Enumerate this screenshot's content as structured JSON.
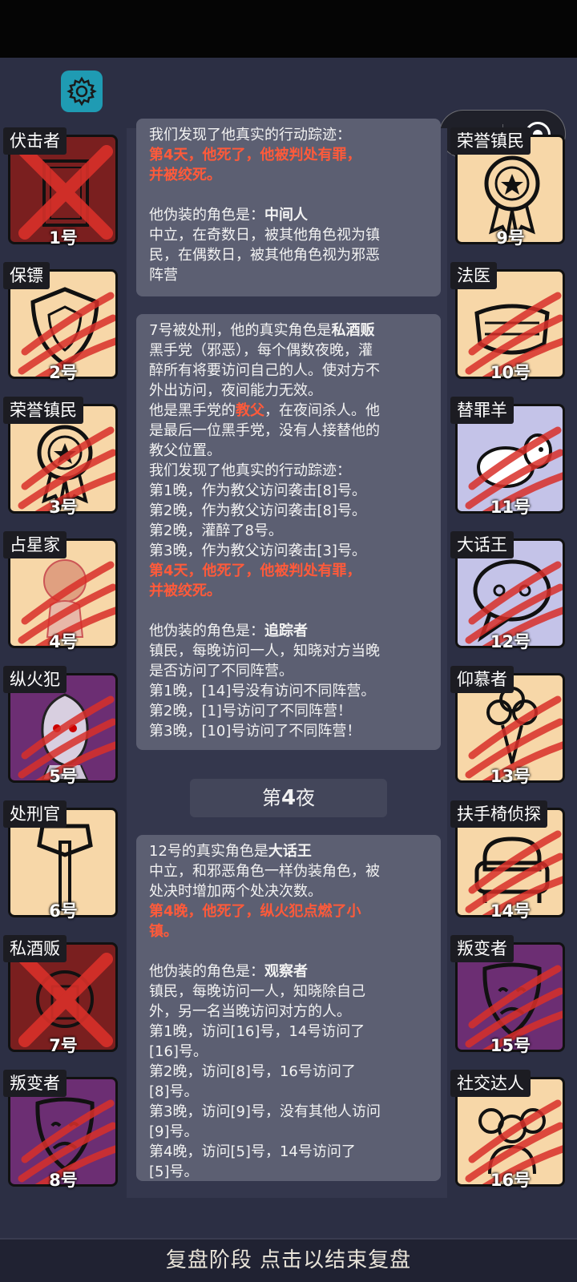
{
  "icons": {
    "settings": "gear-icon",
    "menu": "more-dots-icon",
    "close": "target-close-icon"
  },
  "colors": {
    "background": "#2c2f44",
    "card": "#5c5f72",
    "highlight": "#ff5a3a",
    "settings_button": "#1f9bb3",
    "tile_town": "#f7d7a8",
    "tile_evil": "#6c2e73",
    "tile_neutral": "#c4c3e8"
  },
  "players": [
    {
      "role": "伏击者",
      "number": "1号",
      "icon": "door-icon",
      "tile": "dark",
      "status": "executed"
    },
    {
      "role": "保镖",
      "number": "2号",
      "icon": "shield-icon",
      "tile": "town",
      "status": "clawed"
    },
    {
      "role": "荣誉镇民",
      "number": "3号",
      "icon": "medal-icon",
      "tile": "town",
      "status": "clawed"
    },
    {
      "role": "占星家",
      "number": "4号",
      "icon": "astrologer-icon",
      "tile": "town",
      "status": "clawed"
    },
    {
      "role": "纵火犯",
      "number": "5号",
      "icon": "arsonist-icon",
      "tile": "purple",
      "status": "clawed"
    },
    {
      "role": "处刑官",
      "number": "6号",
      "icon": "axe-icon",
      "tile": "town",
      "status": "alive"
    },
    {
      "role": "私酒贩",
      "number": "7号",
      "icon": "bootlegger-icon",
      "tile": "dark",
      "status": "executed"
    },
    {
      "role": "叛变者",
      "number": "8号",
      "icon": "theater-mask-icon",
      "tile": "purple",
      "status": "clawed"
    },
    {
      "role": "荣誉镇民",
      "number": "9号",
      "icon": "medal-icon",
      "tile": "town",
      "status": "alive"
    },
    {
      "role": "法医",
      "number": "10号",
      "icon": "mask-icon",
      "tile": "town",
      "status": "clawed"
    },
    {
      "role": "替罪羊",
      "number": "11号",
      "icon": "sheep-icon",
      "tile": "lavender",
      "status": "clawed"
    },
    {
      "role": "大话王",
      "number": "12号",
      "icon": "speech-bubble-icon",
      "tile": "lavender",
      "status": "clawed"
    },
    {
      "role": "仰慕者",
      "number": "13号",
      "icon": "bouquet-icon",
      "tile": "town",
      "status": "clawed"
    },
    {
      "role": "扶手椅侦探",
      "number": "14号",
      "icon": "armchair-icon",
      "tile": "town",
      "status": "clawed"
    },
    {
      "role": "叛变者",
      "number": "15号",
      "icon": "theater-mask-icon",
      "tile": "purple",
      "status": "clawed"
    },
    {
      "role": "社交达人",
      "number": "16号",
      "icon": "people-icon",
      "tile": "town",
      "status": "clawed"
    }
  ],
  "log": {
    "card1": {
      "lines": [
        "我们发现了他真实的行动踪迹：",
        "第4天，他死了，他被判处有罪，",
        "并被绞死。",
        "他伪装的角色是：",
        "中间人",
        "中立，在奇数日，被其他角色视为镇",
        "民，在偶数日，被其他角色视为邪恶",
        "阵营"
      ]
    },
    "card2": {
      "lines": [
        "7号被处刑，他的真实角色是",
        "私酒贩",
        "黑手党（邪恶），每个偶数夜晚，灌",
        "醉所有将要访问自己的人。使对方不",
        "外出访问，夜间能力无效。",
        "他是黑手党的",
        "教父",
        "，在夜间杀人。他",
        "是最后一位黑手党，没有人接替他的",
        "教父位置。",
        "我们发现了他真实的行动踪迹：",
        "第1晚，作为教父访问袭击[8]号。",
        "第2晚，作为教父访问袭击[8]号。",
        "第2晚，灌醉了8号。",
        "第3晚，作为教父访问袭击[3]号。",
        "第4天，他死了，他被判处有罪，",
        "并被绞死。",
        "他伪装的角色是：",
        "追踪者",
        "镇民，每晚访问一人，知晓对方当晚",
        "是否访问了不同阵营。",
        "第1晚，[14]号没有访问不同阵营。",
        "第2晚，[1]号访问了不同阵营！",
        "第3晚，[10]号访问了不同阵营！"
      ]
    },
    "night_banner": {
      "prefix": "第",
      "number": "4",
      "suffix": "夜"
    },
    "card3": {
      "lines": [
        "12号的真实角色是",
        "大话王",
        "中立，和邪恶角色一样伪装角色，被",
        "处决时增加两个处决次数。",
        "第4晚，他死了，纵火犯点燃了小",
        "镇。",
        "他伪装的角色是：",
        "观察者",
        "镇民，每晚访问一人，知晓除自己",
        "外，另一名当晚访问对方的人。",
        "第1晚，访问[16]号，14号访问了",
        "[16]号。",
        "第2晚，访问[8]号，16号访问了",
        "[8]号。",
        "第3晚，访问[9]号，没有其他人访问",
        "[9]号。",
        "第4晚，访问[5]号，14号访问了",
        "[5]号。"
      ]
    }
  },
  "bottom_bar": {
    "label": "复盘阶段 点击以结束复盘"
  }
}
